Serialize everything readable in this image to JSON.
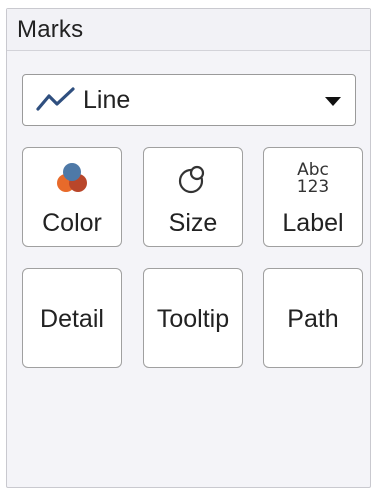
{
  "panel": {
    "title": "Marks"
  },
  "mark_type": {
    "selected": "Line",
    "icon": "line-chart-icon",
    "line_color": "#2f4f7f"
  },
  "cards": {
    "color": {
      "label": "Color",
      "icon": "color-circles-icon",
      "icon_colors": [
        "#4e79a7",
        "#e86a2a",
        "#b9462a"
      ]
    },
    "size": {
      "label": "Size",
      "icon": "size-circles-icon"
    },
    "label": {
      "label": "Label",
      "icon": "abc-123-icon",
      "icon_text_top": "Abc",
      "icon_text_bottom": "123"
    },
    "detail": {
      "label": "Detail"
    },
    "tooltip": {
      "label": "Tooltip"
    },
    "path": {
      "label": "Path"
    }
  }
}
